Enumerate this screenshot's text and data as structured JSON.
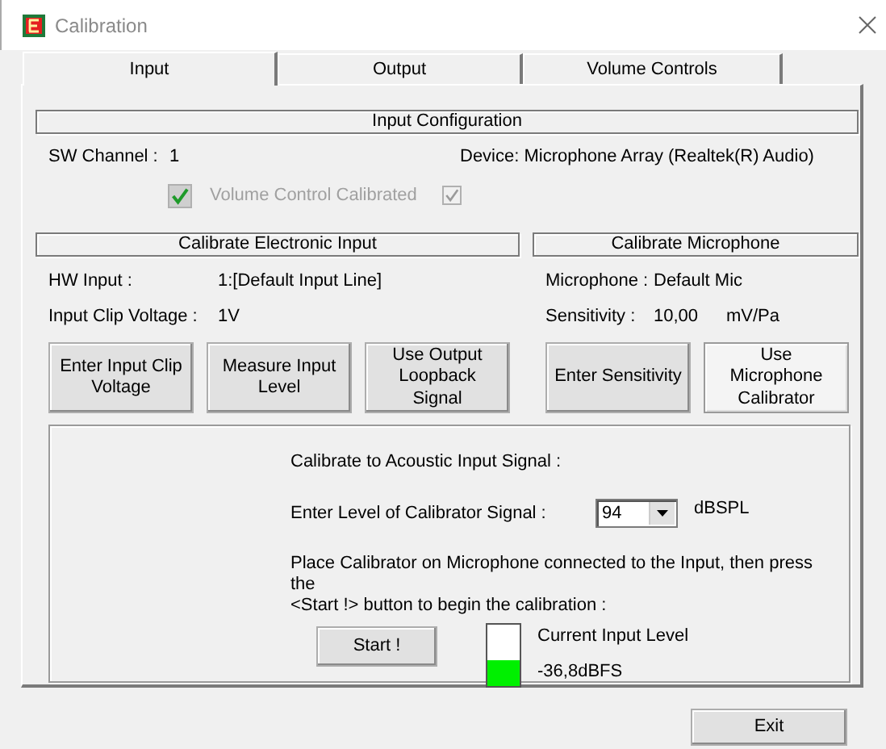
{
  "window": {
    "title": "Calibration"
  },
  "tabs": [
    {
      "label": "Input",
      "selected": true
    },
    {
      "label": "Output",
      "selected": false
    },
    {
      "label": "Volume Controls",
      "selected": false
    }
  ],
  "input_configuration": {
    "header": "Input Configuration",
    "sw_channel": {
      "label": "SW Channel :",
      "value": "1"
    },
    "device": "Device: Microphone Array (Realtek(R) Audio)",
    "volume_control_calibrated": {
      "label": "Volume Control Calibrated",
      "checked": true,
      "disabled": true
    },
    "second_checkbox": {
      "checked": true,
      "disabled": true
    }
  },
  "calibrate_electronic_input": {
    "header": "Calibrate Electronic Input",
    "hw_input": {
      "label": "HW Input :",
      "value": "1:[Default Input Line]"
    },
    "input_clip_voltage": {
      "label": "Input Clip Voltage :",
      "value": "1V"
    },
    "buttons": [
      {
        "label": "Enter Input Clip Voltage",
        "pressed": false
      },
      {
        "label": "Measure Input Level",
        "pressed": false
      },
      {
        "label": "Use Output Loopback Signal",
        "pressed": false
      }
    ]
  },
  "calibrate_microphone": {
    "header": "Calibrate Microphone",
    "microphone": {
      "label": "Microphone :",
      "value": "Default Mic"
    },
    "sensitivity": {
      "label": "Sensitivity :",
      "value": "10,00",
      "unit": "mV/Pa"
    },
    "buttons": [
      {
        "label": "Enter Sensitivity",
        "pressed": false
      },
      {
        "label": "Use Microphone Calibrator",
        "pressed": true
      }
    ]
  },
  "acoustic": {
    "heading": "Calibrate to Acoustic Input Signal :",
    "calibrator_level": {
      "label": "Enter Level of Calibrator Signal :",
      "value": "94",
      "unit": "dBSPL"
    },
    "instructions": "Place Calibrator on Microphone connected to the Input, then press the\n<Start !> button to begin the calibration :",
    "start_button": "Start !",
    "meter": {
      "level": 0.42,
      "label": "Current Input Level",
      "reading": "-36,8dBFS"
    }
  },
  "exit_button": "Exit"
}
